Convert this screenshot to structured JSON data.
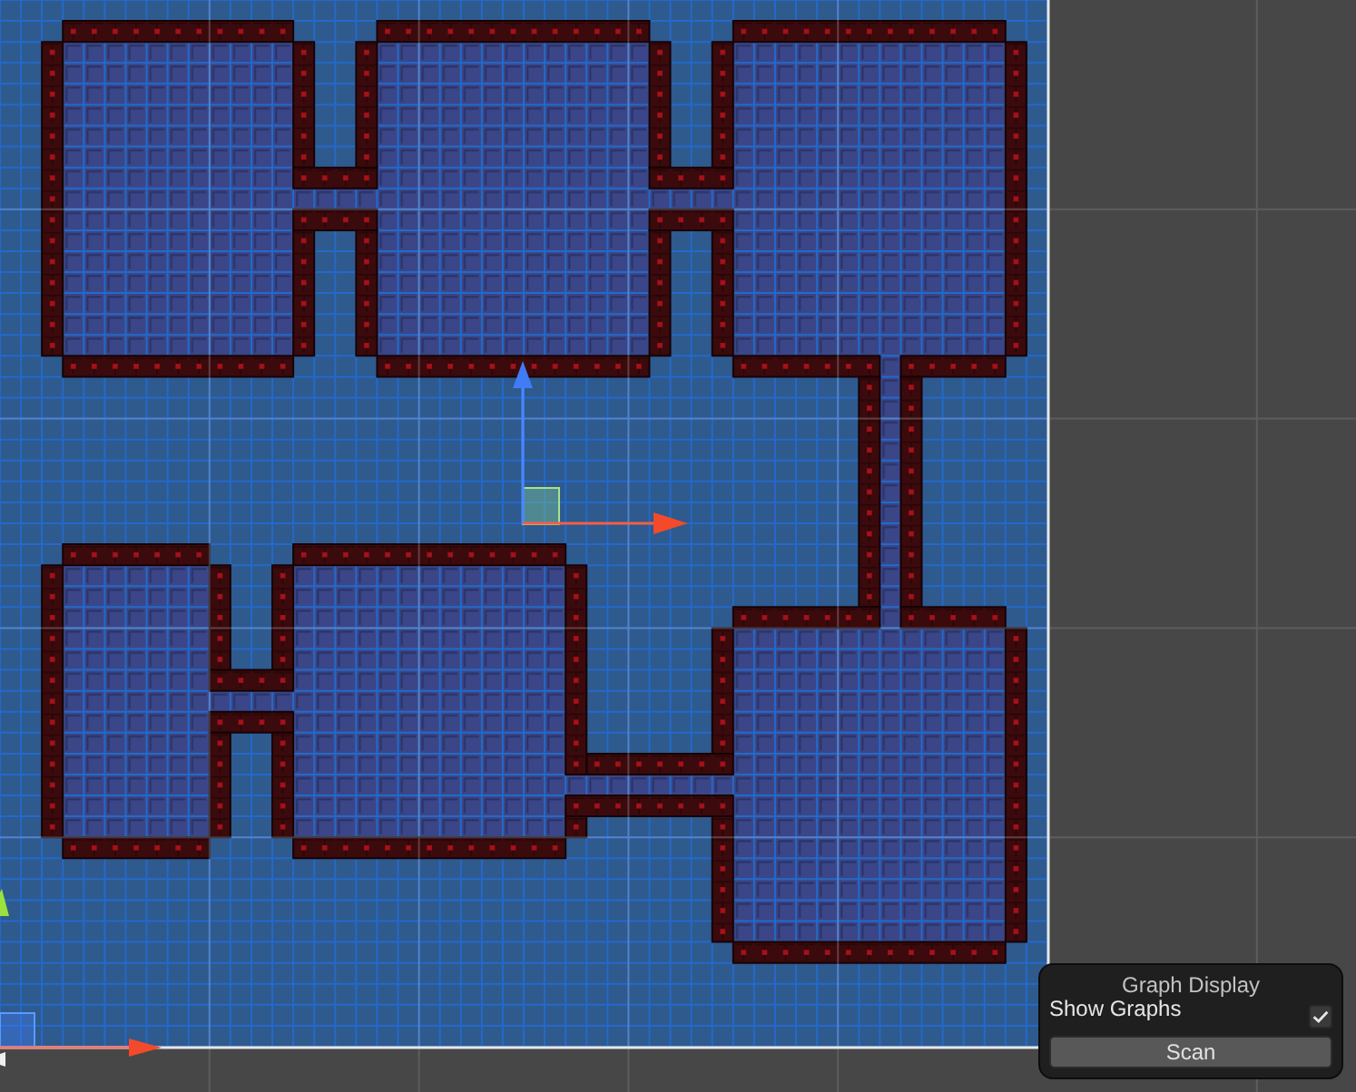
{
  "graph_display": {
    "title": "Graph Display",
    "show_graphs": {
      "label": "Show Graphs",
      "checked": true
    },
    "scan_button": {
      "label": "Scan"
    }
  }
}
